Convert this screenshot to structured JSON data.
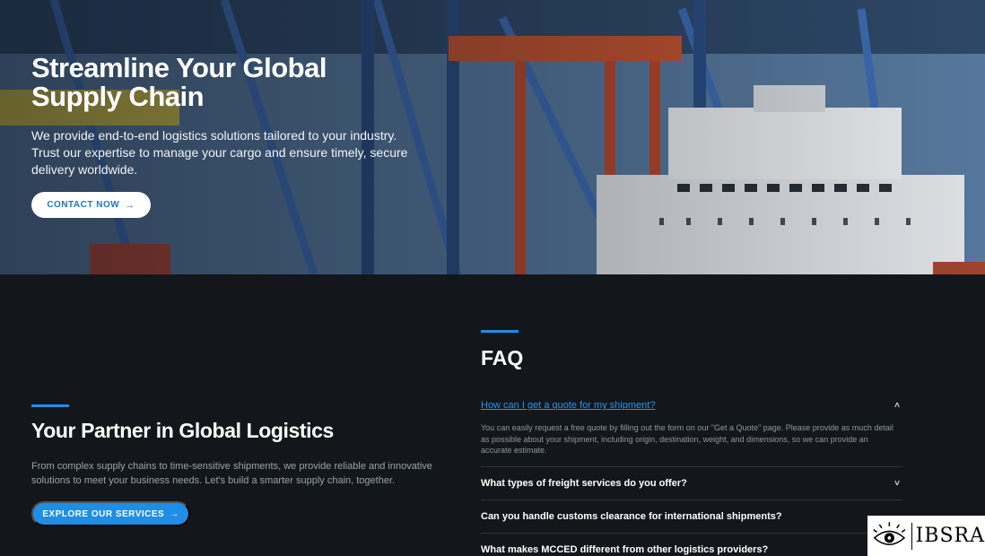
{
  "hero": {
    "title_line1": "Streamline Your Global",
    "title_line2": "Supply Chain",
    "subtitle": "We provide end-to-end logistics solutions tailored to your industry. Trust our expertise to manage your cargo and ensure timely, secure delivery worldwide.",
    "cta_label": "CONTACT NOW",
    "cta_icon": "arrow-right-icon"
  },
  "partner": {
    "title": "Your Partner in Global Logistics",
    "text": "From complex supply chains to time-sensitive shipments, we provide reliable and innovative solutions to meet your business needs. Let's build a smarter supply chain, together.",
    "cta_label": "EXPLORE OUR SERVICES",
    "cta_icon": "arrow-right-icon"
  },
  "faq": {
    "title": "FAQ",
    "items": [
      {
        "question": "How can I get a quote for my shipment?",
        "answer": "You can easily request a free quote by filling out the form on our \"Get a Quote\" page. Please provide as much detail as possible about your shipment, including origin, destination, weight, and dimensions, so we can provide an accurate estimate.",
        "expanded": true
      },
      {
        "question": "What types of freight services do you offer?",
        "expanded": false
      },
      {
        "question": "Can you handle customs clearance for international shipments?",
        "expanded": false
      },
      {
        "question": "What makes MCCED different from other logistics providers?",
        "expanded": false
      }
    ]
  },
  "watermark": {
    "text": "IBSRA"
  },
  "colors": {
    "accent": "#1e8ee6",
    "background": "#13171b",
    "link": "#2196f3"
  }
}
